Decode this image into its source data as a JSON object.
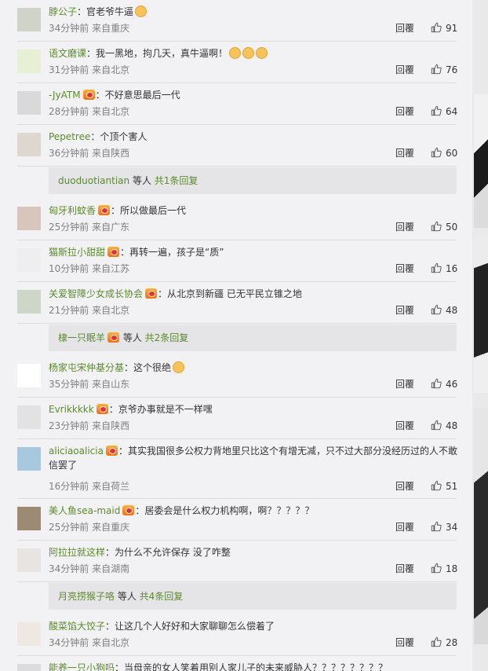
{
  "comments": [
    {
      "user": "脖公子",
      "vip": false,
      "text": "官老爷牛逼",
      "emoji_count": 1,
      "emoji_name": "tired-face-emoji",
      "text2": "",
      "time": "34分钟前",
      "location": "来自重庆",
      "reply_label": "回覆",
      "likes": "91",
      "avatar_color": "#cfd3c8"
    },
    {
      "user": "语文磨课",
      "vip": false,
      "text": "我一黑地，拘几天，真牛逼啊！",
      "emoji_count": 3,
      "emoji_name": "thumbs-up-emoji",
      "text2": "",
      "time": "31分钟前",
      "location": "来自北京",
      "reply_label": "回覆",
      "likes": "76",
      "avatar_color": "#e7efd5"
    },
    {
      "user": "-JyATM",
      "vip": true,
      "text": "不好意思最后一代",
      "emoji_count": 0,
      "emoji_name": "",
      "text2": "",
      "time": "28分钟前",
      "location": "来自北京",
      "reply_label": "回覆",
      "likes": "64",
      "avatar_color": "#d9d9d9"
    },
    {
      "user": "Pepetree",
      "vip": false,
      "text": "个顶个害人",
      "emoji_count": 0,
      "emoji_name": "",
      "text2": "",
      "time": "36分钟前",
      "location": "来自陕西",
      "reply_label": "回覆",
      "likes": "60",
      "avatar_color": "#ded7cf"
    },
    {
      "user": "匈牙利蚊香",
      "vip": true,
      "text": "所以做最后一代",
      "emoji_count": 0,
      "emoji_name": "",
      "text2": "",
      "time": "25分钟前",
      "location": "来自广东",
      "reply_label": "回覆",
      "likes": "50",
      "avatar_color": "#d8c6bd"
    },
    {
      "user": "猫斯拉小甜甜",
      "vip": true,
      "text": "再转一遍，孩子是“质”",
      "emoji_count": 0,
      "emoji_name": "",
      "text2": "",
      "time": "10分钟前",
      "location": "来自江苏",
      "reply_label": "回覆",
      "likes": "16",
      "avatar_color": "#eeeeee"
    },
    {
      "user": "关爱智障少女成长协会",
      "vip": true,
      "text": "从北京到新疆 已无平民立锥之地",
      "emoji_count": 0,
      "emoji_name": "",
      "text2": "",
      "time": "21分钟前",
      "location": "来自北京",
      "reply_label": "回覆",
      "likes": "48",
      "avatar_color": "#cdd7c8"
    },
    {
      "user": "杨家屯宋仲基分基",
      "vip": false,
      "text": "这个很绝",
      "emoji_count": 1,
      "emoji_name": "thumbs-up-emoji",
      "text2": "",
      "time": "35分钟前",
      "location": "来自山东",
      "reply_label": "回覆",
      "likes": "46",
      "avatar_color": "#ffffff"
    },
    {
      "user": "Evrikkkkk",
      "vip": true,
      "text": "京爷办事就是不一样嘿",
      "emoji_count": 0,
      "emoji_name": "",
      "text2": "",
      "time": "23分钟前",
      "location": "来自陕西",
      "reply_label": "回覆",
      "likes": "48",
      "avatar_color": "#e2e2e2"
    },
    {
      "user": "aliciaoalicia",
      "vip": true,
      "text": "其实我国很多公权力背地里只比这个有增无减，只不过大部分没经历过的人不敢",
      "emoji_count": 0,
      "emoji_name": "",
      "text2": "信罢了",
      "time": "16分钟前",
      "location": "来自荷兰",
      "reply_label": "回覆",
      "likes": "51",
      "avatar_color": "#a8c8e0"
    },
    {
      "user": "美人鱼sea-maid",
      "vip": true,
      "text": "居委会是什么权力机构啊，啊？？？？？",
      "emoji_count": 0,
      "emoji_name": "",
      "text2": "",
      "time": "25分钟前",
      "location": "来自重庆",
      "reply_label": "回覆",
      "likes": "34",
      "avatar_color": "#9c8a74"
    },
    {
      "user": "阿拉拉就这样",
      "vip": false,
      "text": "为什么不允许保存 没了咋整",
      "emoji_count": 0,
      "emoji_name": "",
      "text2": "",
      "time": "34分钟前",
      "location": "来自湖南",
      "reply_label": "回覆",
      "likes": "18",
      "avatar_color": "#e8e4e2"
    },
    {
      "user": "酸菜馅大饺子",
      "vip": false,
      "text": "让这几个人好好和大家聊聊怎么偿着了",
      "emoji_count": 0,
      "emoji_name": "",
      "text2": "",
      "time": "34分钟前",
      "location": "来自北京",
      "reply_label": "回覆",
      "likes": "28",
      "avatar_color": "#efe8e2"
    },
    {
      "user": "能养一只小狗吗",
      "vip": false,
      "text": "当母亲的女人笑着用别人家儿子的未来威胁人？？？？？？？？",
      "emoji_count": 0,
      "emoji_name": "",
      "text2": "",
      "time": "",
      "location": "",
      "reply_label": "",
      "likes": "",
      "avatar_color": "#dcdcdc"
    }
  ],
  "sub_replies": [
    {
      "user": "duoduotiantian",
      "vip": false,
      "mid": " 等人 ",
      "count": "共1条回复"
    },
    {
      "user": "棣一只眠羊",
      "vip": true,
      "mid": " 等人 ",
      "count": "共2条回复"
    },
    {
      "user": "月亮捞猴子咯",
      "vip": false,
      "mid": " 等人 ",
      "count": "共4条回复"
    }
  ],
  "icons": {
    "like": "thumbs-up-icon",
    "vip": "vip-badge-icon"
  },
  "colors": {
    "username": "#5b8b2c",
    "meta": "#808080",
    "panel_bg": "#f2f2f5",
    "sub_bg": "#e5e5e8"
  }
}
